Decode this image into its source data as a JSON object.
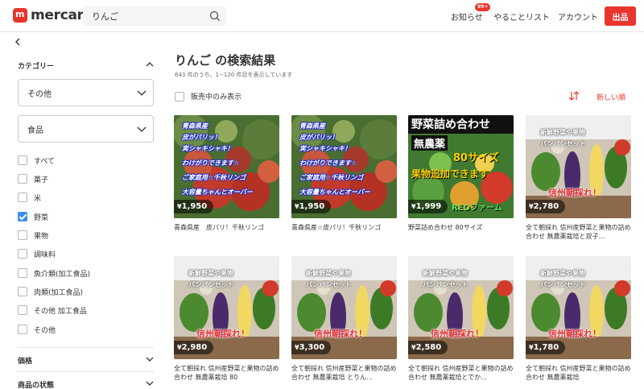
{
  "header": {
    "logo_text": "mercari",
    "search_value": "りんご",
    "nav": {
      "notifications": "お知らせ",
      "notifications_badge": "99+",
      "todo": "やることリスト",
      "account": "アカウント",
      "sell": "出品"
    }
  },
  "sidebar": {
    "category_title": "カテゴリー",
    "select1": "その他",
    "select2": "食品",
    "checkboxes": [
      {
        "label": "すべて",
        "checked": false
      },
      {
        "label": "菓子",
        "checked": false
      },
      {
        "label": "米",
        "checked": false
      },
      {
        "label": "野菜",
        "checked": true
      },
      {
        "label": "果物",
        "checked": false
      },
      {
        "label": "調味料",
        "checked": false
      },
      {
        "label": "魚介類(加工食品)",
        "checked": false
      },
      {
        "label": "肉類(加工食品)",
        "checked": false
      },
      {
        "label": "その他 加工食品",
        "checked": false
      },
      {
        "label": "その他",
        "checked": false
      }
    ],
    "price_title": "価格",
    "condition_title": "商品の状態"
  },
  "main": {
    "title": "りんご の検索結果",
    "subtitle": "643 件のうち、1−120 件目を表示しています",
    "on_sale_only": "販売中のみ表示",
    "sort_label": "新しい順"
  },
  "items": [
    {
      "price": "1,950",
      "name": "青森県産　皮パリ！千秋リンゴ",
      "image": "apple",
      "overlay": [
        "青森県産",
        "皮がパリッ！",
        "実シャキシャキ！",
        "わけがりできます☆",
        "ご家庭用☆千秋リンゴ",
        "大容量ちゃんとオーバー"
      ]
    },
    {
      "price": "1,950",
      "name": "青森県産☆皮パリ！千秋リンゴ",
      "image": "apple",
      "overlay": [
        "青森県産",
        "皮がパリッ！",
        "実シャキシャキ！",
        "わけがりできます☆",
        "ご家庭用☆千秋リンゴ",
        "大容量ちゃんとオーバー"
      ]
    },
    {
      "price": "1,999",
      "name": "野菜詰め合わせ 80サイズ",
      "image": "produce",
      "overlay": [
        "野菜詰め合わせ",
        "無農薬",
        "80サイズ",
        "果物追加できます",
        "REOファーム"
      ]
    },
    {
      "price": "2,780",
      "name": "全て朝採れ 信州産野菜と果物の詰め合わせ 無農薬栽培と双子…",
      "image": "veg",
      "overlay": [
        "新鮮野菜や果物",
        "パンパンセット",
        "信州朝採れ！"
      ]
    },
    {
      "price": "2,980",
      "name": "全て朝採れ 信州産野菜と果物の詰め合わせ 無農薬栽培 80",
      "image": "veg",
      "overlay": [
        "新鮮野菜や果物",
        "パンパンセット",
        "信州朝採れ！"
      ]
    },
    {
      "price": "3,300",
      "name": "全て朝採れ 信州産野菜と果物の詰め合わせ 無農薬栽培 とりん…",
      "image": "veg",
      "overlay": [
        "新鮮野菜や果物",
        "パンパンセット",
        "信州朝採れ！"
      ]
    },
    {
      "price": "2,580",
      "name": "全て朝採れ 信州産野菜と果物の詰め合わせ 無農薬栽培とでか…",
      "image": "veg",
      "overlay": [
        "新鮮野菜や果物",
        "パンパンセット",
        "信州朝採れ！"
      ]
    },
    {
      "price": "1,780",
      "name": "全て朝採れ 信州産野菜と果物の詰め合わせ 無農薬栽培",
      "image": "veg",
      "overlay": [
        "新鮮野菜や果物",
        "パンパンセット",
        "信州朝採れ！"
      ]
    }
  ],
  "colors": {
    "brand": "#ea352d",
    "checkbox_checked": "#3a8df0"
  }
}
